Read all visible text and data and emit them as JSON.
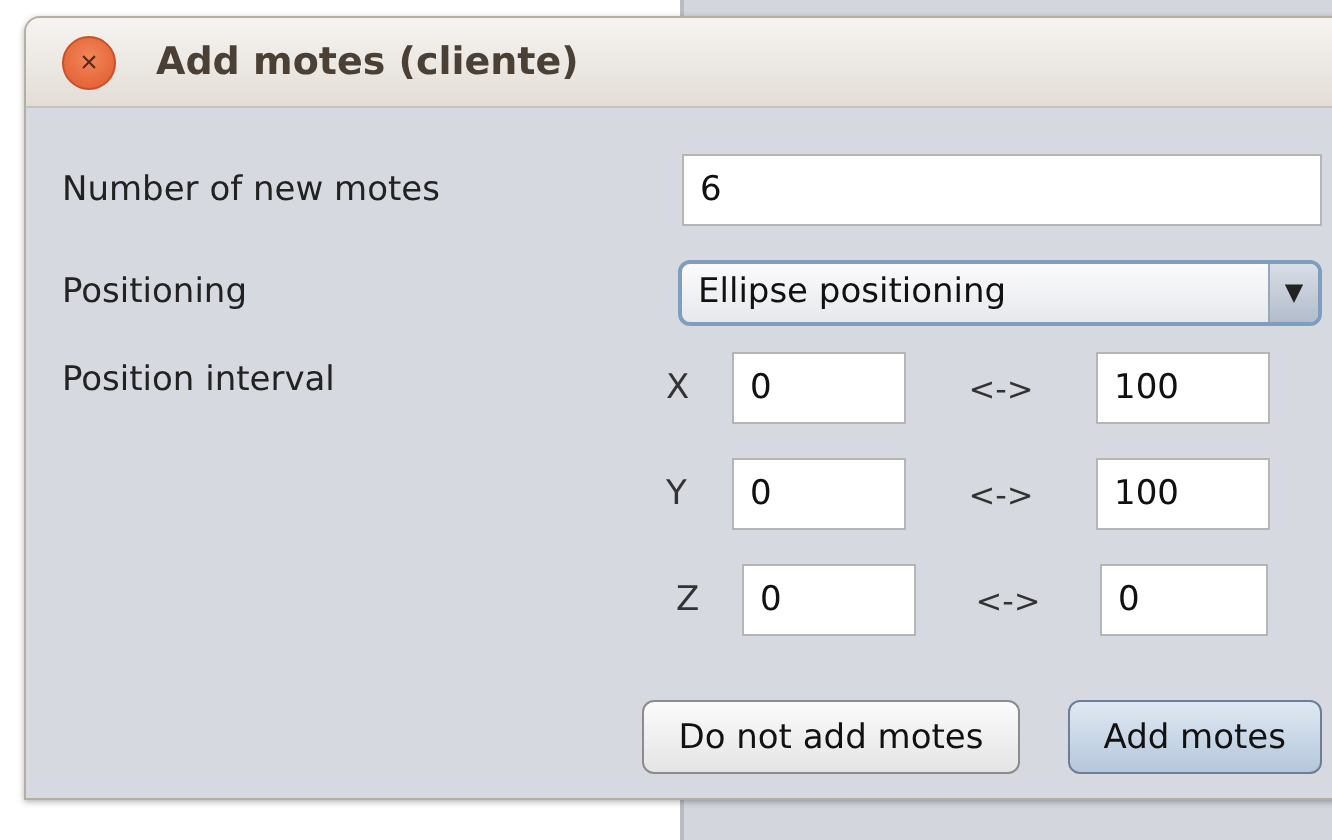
{
  "window": {
    "title": "Add motes (cliente)",
    "close_icon": "×"
  },
  "fields": [
    {
      "label": "Number of new motes",
      "value": "6"
    }
  ],
  "positioning": {
    "label": "Positioning",
    "value": "Ellipse positioning",
    "arrow": "▼"
  },
  "interval": {
    "label": "Position interval",
    "rows": [
      {
        "axis": "X",
        "min": "0",
        "separator": "<->",
        "max": "100"
      },
      {
        "axis": "Y",
        "min": "0",
        "separator": "<->",
        "max": "100"
      },
      {
        "axis": "Z",
        "min": "0",
        "separator": "<->",
        "max": "0"
      }
    ]
  },
  "buttons": [
    {
      "label": "Do not add motes",
      "default": false
    },
    {
      "label": "Add motes",
      "default": true
    }
  ]
}
